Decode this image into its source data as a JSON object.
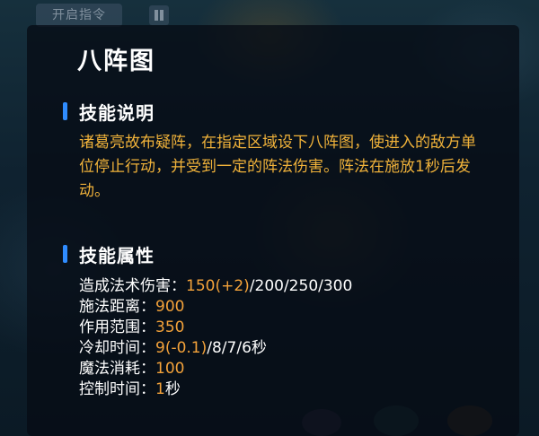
{
  "topbar": {
    "command_button_label": "开启指令",
    "pause_icon": "pause-icon"
  },
  "skill": {
    "name": "八阵图",
    "description_heading": "技能说明",
    "description": "诸葛亮故布疑阵，在指定区域设下八阵图，使进入的敌方单位停止行动，并受到一定的阵法伤害。阵法在施放1秒后发动。",
    "attributes_heading": "技能属性",
    "attributes": [
      {
        "label": "造成法术伤害：",
        "highlight": "150(+2)",
        "rest": "/200/250/300",
        "suffix": ""
      },
      {
        "label": "施法距离：",
        "highlight": "900",
        "rest": "",
        "suffix": ""
      },
      {
        "label": "作用范围：",
        "highlight": "350",
        "rest": "",
        "suffix": ""
      },
      {
        "label": "冷却时间：",
        "highlight": "9(-0.1)",
        "rest": "/8/7/6",
        "suffix": "秒"
      },
      {
        "label": "魔法消耗：",
        "highlight": "100",
        "rest": "",
        "suffix": ""
      },
      {
        "label": "控制时间：",
        "highlight": "1",
        "rest": "",
        "suffix": "秒"
      }
    ]
  },
  "colors": {
    "accent_blue": "#2f8cff",
    "value_orange": "#f3a23a",
    "description_gold": "#f0b23a",
    "heading_white": "#ffffff"
  }
}
